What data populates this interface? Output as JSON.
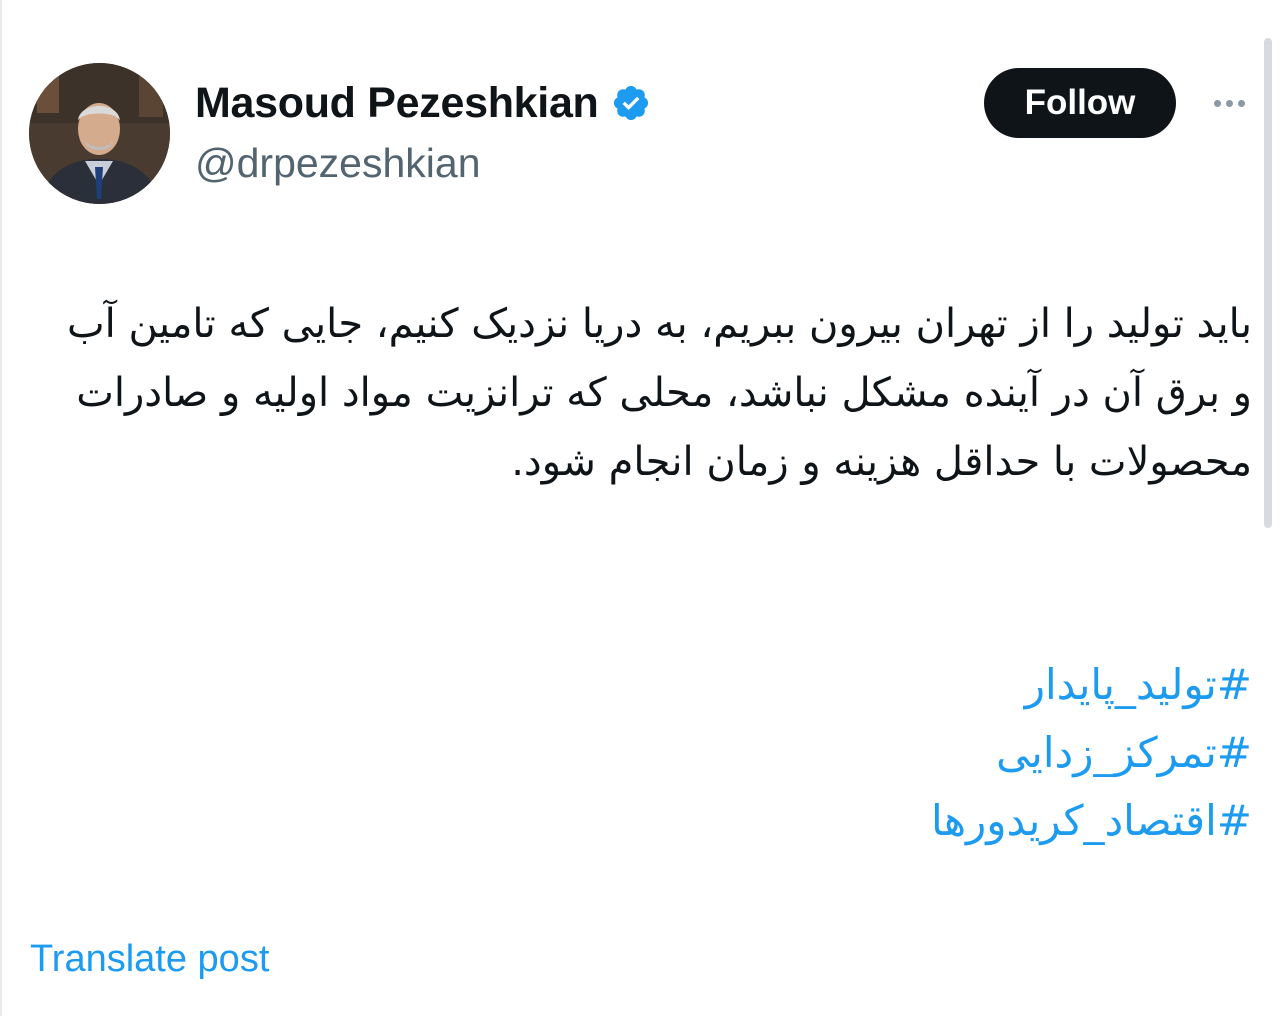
{
  "author": {
    "display_name": "Masoud Pezeshkian",
    "handle": "@drpezeshkian",
    "verified": true,
    "avatar_icon": "profile-photo"
  },
  "actions": {
    "follow_label": "Follow",
    "more_icon": "more-horizontal-icon"
  },
  "post": {
    "text": "باید تولید را از تهران بیرون ببریم، به دریا نزدیک کنیم، جایی که تامین آب و برق آن در آینده مشکل نباشد، محلی که ترانزیت مواد اولیه و صادرات محصولات با حداقل هزینه و زمان انجام شود.",
    "hashtags": [
      "#تولید_پایدار",
      "#تمرکز_زدایی",
      "#اقتصاد_کریدورها"
    ]
  },
  "translate_label": "Translate post",
  "colors": {
    "text": "#0f1419",
    "secondary": "#536471",
    "link": "#1d9bf0",
    "verified": "#1d9bf0",
    "button_bg": "#0f1419"
  }
}
